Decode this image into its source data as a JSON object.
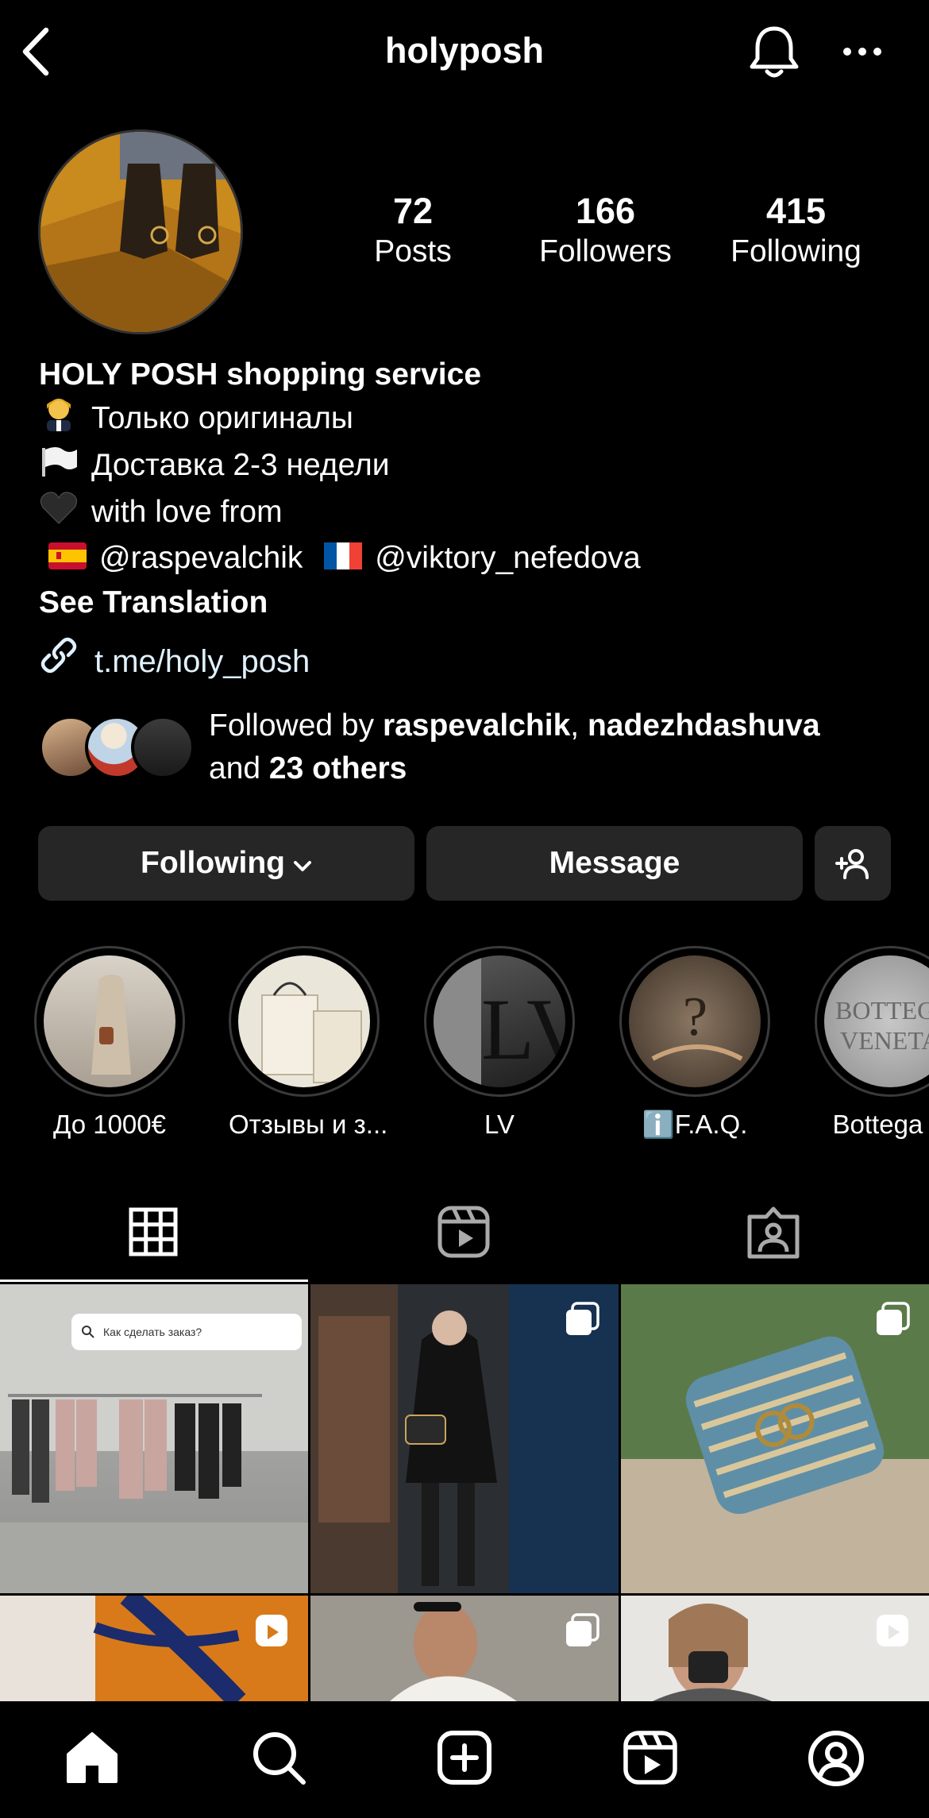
{
  "header": {
    "username": "holyposh",
    "back_icon": "chevron-left-icon",
    "bell_icon": "bell-icon",
    "more_icon": "ellipsis-icon"
  },
  "stats": {
    "posts": {
      "value": "72",
      "label": "Posts"
    },
    "followers": {
      "value": "166",
      "label": "Followers"
    },
    "following": {
      "value": "415",
      "label": "Following"
    }
  },
  "bio": {
    "name": "HOLY POSH shopping service",
    "line1": "Только оригиналы",
    "line2": "Доставка 2-3 недели",
    "line3": "with love from",
    "mention1": "@raspevalchik",
    "mention2": "@viktory_nefedova",
    "see_translation": "See Translation"
  },
  "link": {
    "url": "t.me/holy_posh"
  },
  "followed_by": {
    "prefix": "Followed by ",
    "user1": "raspevalchik",
    "sep": ", ",
    "user2": "nadezhdashuva",
    "and": "and ",
    "others": "23 others"
  },
  "buttons": {
    "following": "Following",
    "message": "Message"
  },
  "highlights": [
    {
      "label": "До 1000€"
    },
    {
      "label": "Отзывы и з..."
    },
    {
      "label": "LV"
    },
    {
      "label": "ℹ️F.A.Q."
    },
    {
      "label": "Bottega V"
    }
  ],
  "post1_search": "Как сделать заказ?",
  "colors": {
    "background": "#000000",
    "button_bg": "#262626",
    "link": "#e0f1ff"
  }
}
